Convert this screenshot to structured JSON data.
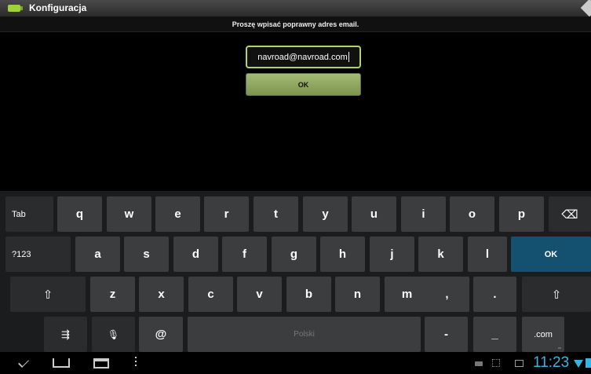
{
  "titlebar": {
    "title": "Konfiguracja"
  },
  "banner": {
    "message": "Proszę wpisać poprawny adres email."
  },
  "form": {
    "email_value": "navroad@navroad.com",
    "ok_label": "OK"
  },
  "keyboard": {
    "row1": [
      "q",
      "w",
      "e",
      "r",
      "t",
      "y",
      "u",
      "i",
      "o",
      "p"
    ],
    "row2": [
      "a",
      "s",
      "d",
      "f",
      "g",
      "h",
      "j",
      "k",
      "l"
    ],
    "row3": [
      "z",
      "x",
      "c",
      "v",
      "b",
      "n",
      "m",
      ",",
      "."
    ],
    "tab_label": "Tab",
    "sym_label": "?123",
    "enter_label": "OK",
    "at_label": "@",
    "space_label": "Polski",
    "dash_label": "-",
    "underscore_label": "_",
    "dotcom_label": ".com",
    "backspace_glyph": "⌫",
    "shift_glyph": "⇧",
    "settings_glyph": "⇶",
    "mic_glyph": "🎙"
  },
  "statusbar": {
    "time": "11:23"
  },
  "colors": {
    "accent": "#33b5e5",
    "enter_key": "#14506f",
    "input_border": "#b3d365"
  }
}
